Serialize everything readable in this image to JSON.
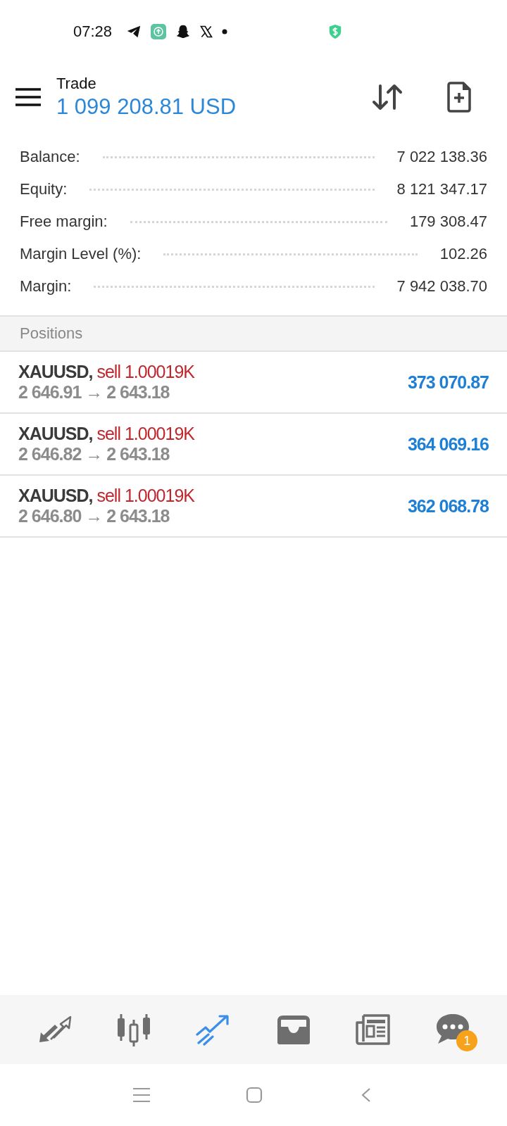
{
  "status_bar": {
    "time": "07:28"
  },
  "header": {
    "title": "Trade",
    "equity": "1 099 208.81 USD"
  },
  "summary": [
    {
      "label": "Balance:",
      "value": "7 022 138.36"
    },
    {
      "label": "Equity:",
      "value": "8 121 347.17"
    },
    {
      "label": "Free margin:",
      "value": "179 308.47"
    },
    {
      "label": "Margin Level (%):",
      "value": "102.26"
    },
    {
      "label": "Margin:",
      "value": "7 942 038.70"
    }
  ],
  "section_title": "Positions",
  "positions": [
    {
      "symbol": "XAUUSD,",
      "order": "sell 1.00019K",
      "open_price": "2 646.91",
      "arrow": "→",
      "current_price": "2 643.18",
      "profit": "373 070.87"
    },
    {
      "symbol": "XAUUSD,",
      "order": "sell 1.00019K",
      "open_price": "2 646.82",
      "arrow": "→",
      "current_price": "2 643.18",
      "profit": "364 069.16"
    },
    {
      "symbol": "XAUUSD,",
      "order": "sell 1.00019K",
      "open_price": "2 646.80",
      "arrow": "→",
      "current_price": "2 643.18",
      "profit": "362 068.78"
    }
  ],
  "tabs": [
    {
      "kind": "quotes",
      "selected": false
    },
    {
      "kind": "chart",
      "selected": false
    },
    {
      "kind": "trade",
      "selected": true
    },
    {
      "kind": "history",
      "selected": false
    },
    {
      "kind": "news",
      "selected": false
    },
    {
      "kind": "messages",
      "selected": false,
      "badge": "1"
    }
  ]
}
